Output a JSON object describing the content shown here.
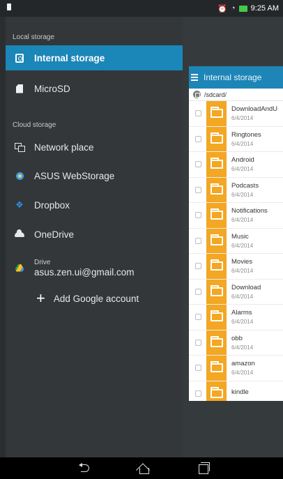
{
  "status_bar": {
    "time": "9:25 AM",
    "icons": [
      "sim-icon",
      "alarm-icon",
      "wifi-icon",
      "battery-icon"
    ]
  },
  "drawer": {
    "local_header": "Local storage",
    "local_items": [
      {
        "label": "Internal storage",
        "icon": "internal-storage-icon",
        "selected": true
      },
      {
        "label": "MicroSD",
        "icon": "sd-card-icon",
        "selected": false
      }
    ],
    "cloud_header": "Cloud storage",
    "cloud_items": [
      {
        "label": "Network place",
        "icon": "network-icon"
      },
      {
        "label": "ASUS WebStorage",
        "icon": "asus-webstorage-icon"
      },
      {
        "label": "Dropbox",
        "icon": "dropbox-icon"
      },
      {
        "label": "OneDrive",
        "icon": "onedrive-icon"
      }
    ],
    "drive": {
      "title": "Drive",
      "account": "asus.zen.ui@gmail.com",
      "icon": "google-drive-icon"
    },
    "add_account_label": "Add Google account"
  },
  "file_manager": {
    "title": "Internal storage",
    "path": "/sdcard/",
    "folders": [
      {
        "name": "DownloadAndU",
        "date": "6/4/2014"
      },
      {
        "name": "Ringtones",
        "date": "6/4/2014"
      },
      {
        "name": "Android",
        "date": "6/4/2014"
      },
      {
        "name": "Podcasts",
        "date": "6/4/2014"
      },
      {
        "name": "Notifications",
        "date": "6/4/2014"
      },
      {
        "name": "Music",
        "date": "6/4/2014"
      },
      {
        "name": "Movies",
        "date": "6/4/2014"
      },
      {
        "name": "Download",
        "date": "6/4/2014"
      },
      {
        "name": "Alarms",
        "date": "6/4/2014"
      },
      {
        "name": "obb",
        "date": "6/4/2014"
      },
      {
        "name": "amazon",
        "date": "6/4/2014"
      },
      {
        "name": "kindle",
        "date": ""
      }
    ]
  },
  "colors": {
    "accent": "#1b86b8",
    "drawer_bg": "#333739",
    "folder": "#f3a722"
  }
}
